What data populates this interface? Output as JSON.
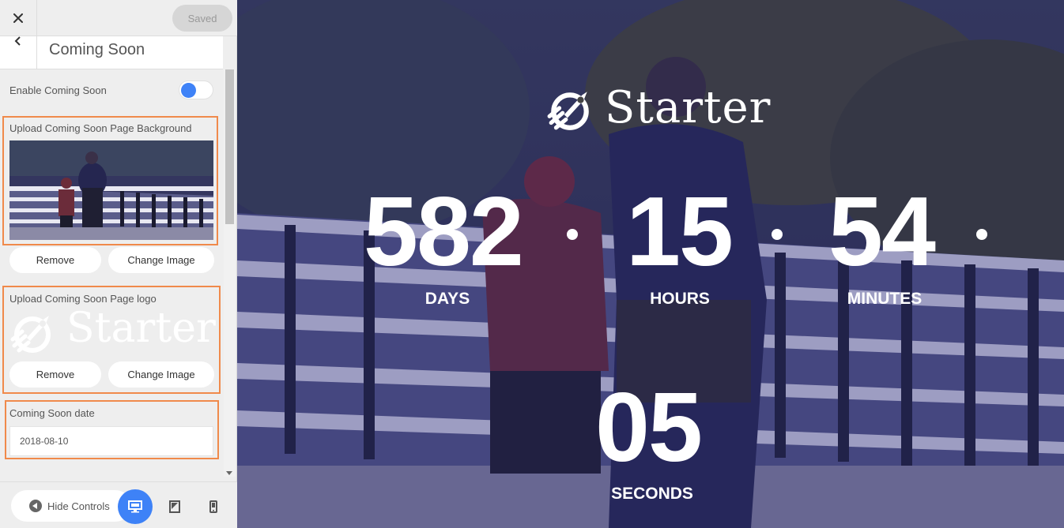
{
  "topbar": {
    "close_icon": "close-icon",
    "saved_label": "Saved"
  },
  "section": {
    "back_icon": "chevron-left-icon",
    "title": "Coming Soon"
  },
  "controls": {
    "enable_label": "Enable Coming Soon",
    "enable_value": true,
    "background": {
      "label": "Upload Coming Soon Page Background",
      "remove_label": "Remove",
      "change_label": "Change Image"
    },
    "logo": {
      "label": "Upload Coming Soon Page logo",
      "logo_text": "Starter",
      "remove_label": "Remove",
      "change_label": "Change Image"
    },
    "date": {
      "label": "Coming Soon date",
      "value": "2018-08-10"
    }
  },
  "footer": {
    "hide_controls_label": "Hide Controls",
    "devices": [
      "desktop-icon",
      "tablet-icon",
      "mobile-icon"
    ],
    "active_device": "desktop"
  },
  "preview": {
    "brand": "Starter",
    "countdown": {
      "days": "582",
      "days_label": "DAYS",
      "hours": "15",
      "hours_label": "HOURS",
      "minutes": "54",
      "minutes_label": "MINUTES",
      "seconds": "05",
      "seconds_label": "SECONDS"
    }
  },
  "colors": {
    "accent": "#3e82f7",
    "highlight_border": "#f08a4b",
    "overlay": "#2c2c58"
  }
}
